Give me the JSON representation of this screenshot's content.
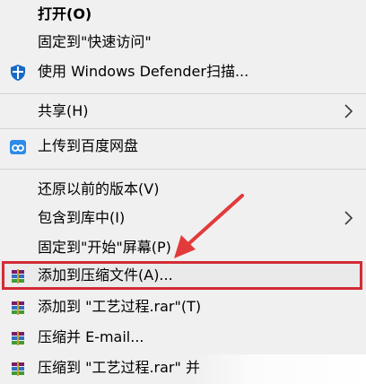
{
  "menu": {
    "items": [
      {
        "label": "打开(O)"
      },
      {
        "label": "固定到\"快速访问\""
      },
      {
        "label": "使用 Windows Defender扫描..."
      },
      {
        "label": "共享(H)"
      },
      {
        "label": "上传到百度网盘"
      },
      {
        "label": "还原以前的版本(V)"
      },
      {
        "label": "包含到库中(I)"
      },
      {
        "label": "固定到\"开始\"屏幕(P)"
      },
      {
        "label": "添加到压缩文件(A)..."
      },
      {
        "label": "添加到 \"工艺过程.rar\"(T)"
      },
      {
        "label": "压缩并 E-mail..."
      },
      {
        "label": "压缩到 \"工艺过程.rar\" 并"
      }
    ]
  },
  "icons": {
    "defender": "shield-icon",
    "baidu": "cloud-icon",
    "winrar": "winrar-icon",
    "submenu": "chevron-right-icon"
  },
  "colors": {
    "menu_bg": "#f0f0f0",
    "separator": "#d3d3d3",
    "highlight_box": "#d32b35",
    "defender_blue": "#1769c7",
    "baidu_blue": "#2c8be8"
  }
}
